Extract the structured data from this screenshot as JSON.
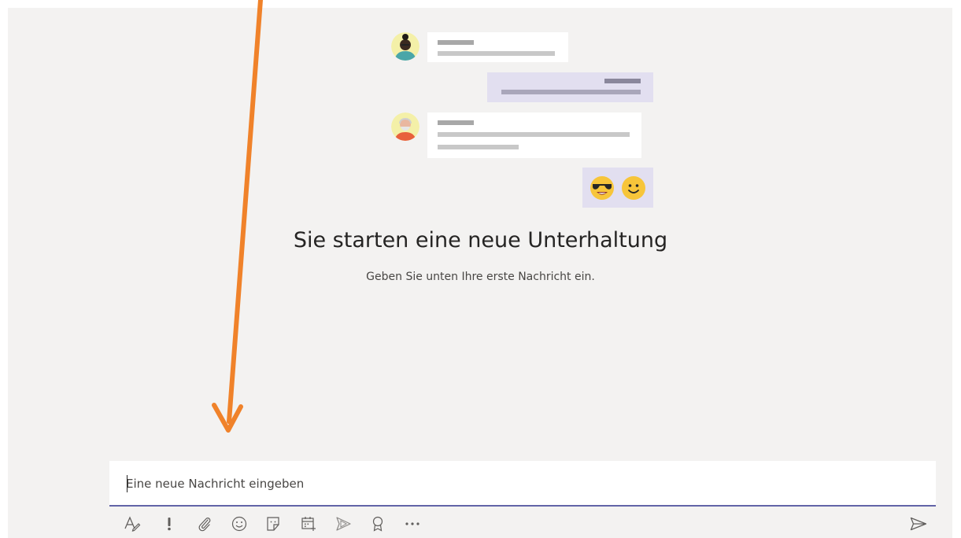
{
  "empty_state": {
    "title": "Sie starten eine neue Unterhaltung",
    "subtitle": "Geben Sie unten Ihre erste Nachricht ein."
  },
  "compose": {
    "placeholder": "Eine neue Nachricht eingeben"
  },
  "toolbar": {
    "icons": [
      "format-icon",
      "important-icon",
      "attach-icon",
      "emoji-icon",
      "sticker-icon",
      "schedule-meeting-icon",
      "stream-icon",
      "praise-icon",
      "more-options-icon"
    ],
    "send_icon": "send-icon"
  },
  "colors": {
    "accent": "#6264a7",
    "annotation_arrow": "#f0822a",
    "chat_background": "#f3f2f1"
  }
}
